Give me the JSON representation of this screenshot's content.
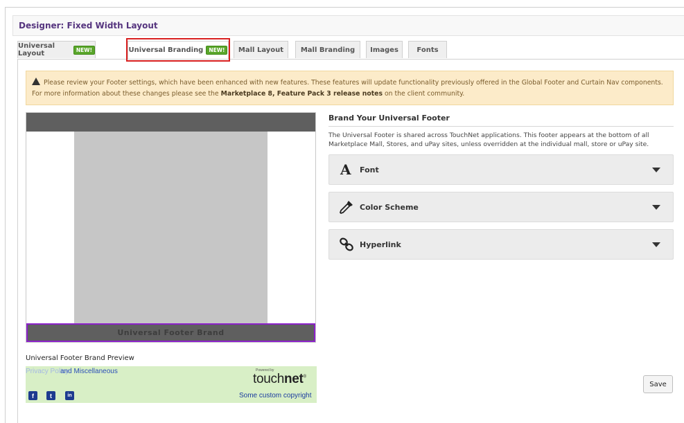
{
  "designer": {
    "title": "Designer: Fixed Width Layout"
  },
  "tabs": [
    {
      "label": "Universal Layout",
      "badge": "NEW!"
    },
    {
      "label": "Universal Branding",
      "badge": "NEW!",
      "active": true
    },
    {
      "label": "Mall Layout"
    },
    {
      "label": "Mall Branding"
    },
    {
      "label": "Images"
    },
    {
      "label": "Fonts"
    }
  ],
  "alert": {
    "text1": "Please review your Footer settings, which have been enhanced with new features. These features will update functionality previously offered in the Global Footer and Curtain Nav components. For more information about these changes please see the ",
    "link": "Marketplace 8, Feature Pack 3 release notes",
    "text2": " on the client community.",
    "icon": "warning-icon"
  },
  "preview": {
    "footer_label": "Universal Footer Brand",
    "caption": "Universal Footer Brand Preview"
  },
  "footer_preview": {
    "link1": "Privacy Policy",
    "link2": "and Miscellaneous",
    "powered_by": "Powered by",
    "logo_light": "touch",
    "logo_bold": "net",
    "logo_mark": "®",
    "copyright": "Some custom copyright",
    "social": [
      {
        "icon": "facebook-icon",
        "glyph": "f"
      },
      {
        "icon": "twitter-icon",
        "glyph": "t"
      },
      {
        "icon": "linkedin-icon",
        "glyph": "in"
      }
    ],
    "bg_color": "#d8efc6"
  },
  "brand_panel": {
    "title": "Brand Your Universal Footer",
    "description": "The Universal Footer is shared across TouchNet applications. This footer appears at the bottom of all Marketplace Mall, Stores, and uPay sites, unless overridden at the individual mall, store or uPay site.",
    "sections": [
      {
        "label": "Font",
        "icon": "font-icon"
      },
      {
        "label": "Color Scheme",
        "icon": "eyedropper-icon"
      },
      {
        "label": "Hyperlink",
        "icon": "link-icon"
      }
    ]
  },
  "actions": {
    "save": "Save"
  },
  "colors": {
    "accent_purple": "#56357f",
    "highlight_red": "#d81f1f",
    "footer_border": "#8b21c9",
    "badge_green": "#5aa62b"
  }
}
